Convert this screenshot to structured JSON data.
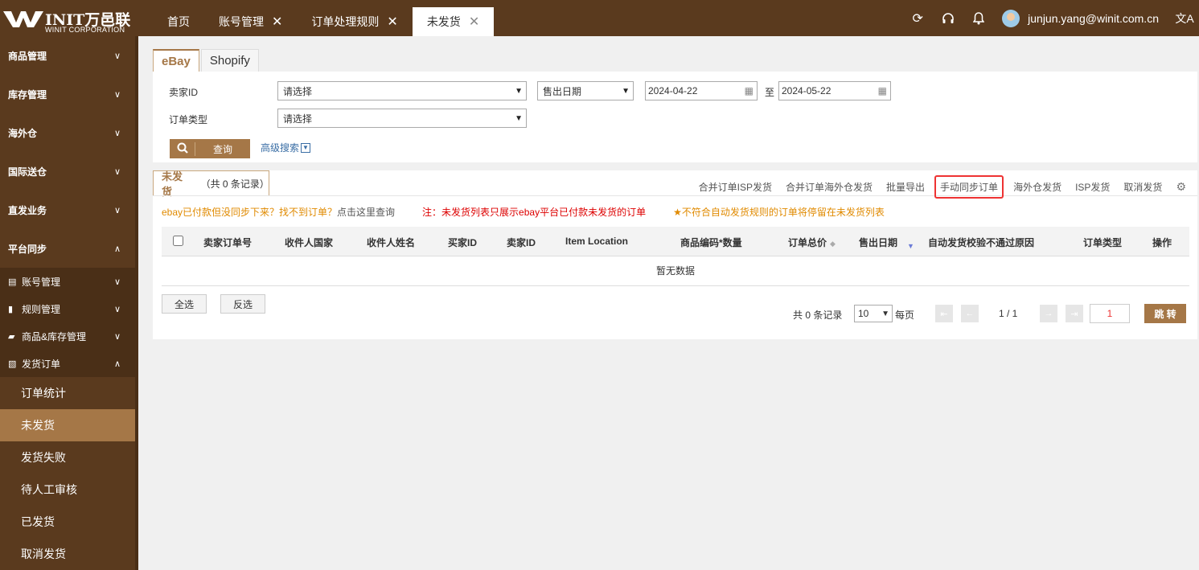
{
  "header": {
    "brand": "INIT万邑联",
    "brand_sub": "WINIT CORPORATION",
    "tabs": [
      {
        "label": "首页",
        "closable": false
      },
      {
        "label": "账号管理",
        "closable": true
      },
      {
        "label": "订单处理规则",
        "closable": true
      },
      {
        "label": "未发货",
        "closable": true,
        "active": true
      }
    ],
    "user_email": "junjun.yang@winit.com.cn",
    "icons": [
      "refresh-icon",
      "headset-icon",
      "bell-icon",
      "translate-icon"
    ]
  },
  "sidebar": {
    "groups": [
      {
        "label": "商品管理"
      },
      {
        "label": "库存管理"
      },
      {
        "label": "海外仓"
      },
      {
        "label": "国际送仓"
      },
      {
        "label": "直发业务"
      },
      {
        "label": "平台同步",
        "expanded": true
      }
    ],
    "sub_groups": [
      {
        "label": "账号管理"
      },
      {
        "label": "规则管理"
      },
      {
        "label": "商品&库存管理"
      },
      {
        "label": "发货订单",
        "expanded": true
      }
    ],
    "leaves": [
      {
        "label": "订单统计"
      },
      {
        "label": "未发货",
        "active": true
      },
      {
        "label": "发货失败"
      },
      {
        "label": "待人工审核"
      },
      {
        "label": "已发货"
      },
      {
        "label": "取消发货"
      }
    ]
  },
  "platform_tabs": [
    {
      "label": "eBay",
      "active": true
    },
    {
      "label": "Shopify"
    }
  ],
  "filter": {
    "seller_label": "卖家ID",
    "seller_value": "请选择",
    "date_type_value": "售出日期",
    "date_from": "2024-04-22",
    "date_sep": "至",
    "date_to": "2024-05-22",
    "order_type_label": "订单类型",
    "order_type_value": "请选择",
    "query_label": "查询",
    "advanced_label": "高级搜索"
  },
  "list": {
    "tab_label": "未发货",
    "count_text": "（共 0 条记录）",
    "actions": [
      {
        "label": "合并订单ISP发货"
      },
      {
        "label": "合并订单海外仓发货"
      },
      {
        "label": "批量导出"
      },
      {
        "label": "手动同步订单",
        "highlighted": true
      },
      {
        "label": "海外仓发货"
      },
      {
        "label": "ISP发货"
      },
      {
        "label": "取消发货"
      }
    ],
    "note_1": "ebay已付款但没同步下来？找不到订单？",
    "note_1_link": "点击这里查询",
    "note_2": "注：未发货列表只展示ebay平台已付款未发货的订单",
    "note_3": "不符合自动发货规则的订单将停留在未发货列表",
    "columns": [
      "卖家订单号",
      "收件人国家",
      "收件人姓名",
      "买家ID",
      "卖家ID",
      "Item Location",
      "商品编码*数量",
      "订单总价",
      "售出日期",
      "自动发货校验不通过原因",
      "订单类型",
      "操作"
    ],
    "empty_text": "暂无数据",
    "select_all": "全选",
    "invert_select": "反选",
    "total_text": "共 0 条记录",
    "page_size": "10",
    "per_page": "每页",
    "page_indicator": "1 / 1",
    "page_input": "1",
    "jump_label": "跳 转"
  }
}
